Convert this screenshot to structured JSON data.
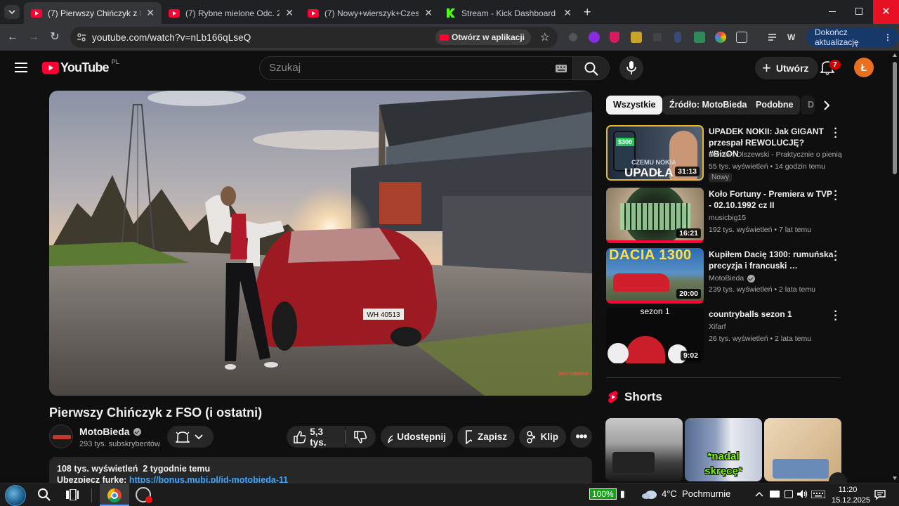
{
  "browser": {
    "tabs": [
      {
        "label": "(7) Pierwszy Chińczyk z FSO (i o",
        "active": true
      },
      {
        "label": "(7) Rybne mielone Odc. 219 #st",
        "active": false
      },
      {
        "label": "(7) Nowy+wierszyk+Czesia xvid",
        "active": false
      },
      {
        "label": "Stream - Kick Dashboard",
        "active": false
      }
    ],
    "url": "youtube.com/watch?v=nLb166qLseQ",
    "open_in_app": "Otwórz w aplikacji",
    "update_label": "Dokończ aktualizację"
  },
  "youtube": {
    "logo_text": "YouTube",
    "region": "PL",
    "search_placeholder": "Szukaj",
    "create_label": "Utwórz",
    "notifications": "7",
    "avatar_letter": "Ł"
  },
  "video": {
    "title": "Pierwszy Chińczyk z FSO (i ostatni)",
    "plate": "WH 40513",
    "watermark": "MOTOBIEDA",
    "channel": "MotoBieda",
    "subscribers": "293 tys. subskrybentów",
    "likes": "5,3 tys.",
    "share": "Udostępnij",
    "save": "Zapisz",
    "clip": "Klip",
    "views_line": "108 tys. wyświetleń  2 tygodnie temu",
    "desc_prefix": "Ubezpiecz furkę: ",
    "desc_link": "https://bonus.mubi.pl/id-motobieda-11"
  },
  "sidebar": {
    "chips": [
      "Wszystkie",
      "Źródło: MotoBieda",
      "Podobne",
      "D"
    ],
    "recommendations": [
      {
        "title": "UPADEK NOKII: Jak GIGANT przespał REWOLUCJĘ? #BizON",
        "channel": "Damian Olszewski - Praktycznie o pienią…",
        "meta": "55 tys. wyświetleń • 14 godzin temu",
        "duration": "31:13",
        "badge": "Nowy",
        "thumb_text": "UPADŁA",
        "thumb_top": "CZEMU NOKIA",
        "thumb_price": "$300"
      },
      {
        "title": "Koło Fortuny - Premiera w TVP - 02.10.1992 cz II",
        "channel": "musicbig15",
        "meta": "192 tys. wyświetleń • 7 lat temu",
        "duration": "16:21"
      },
      {
        "title": "Kupiłem Dacię 1300: rumuńska precyzja i francuski …",
        "channel": "MotoBieda",
        "meta": "239 tys. wyświetleń • 2 lata temu",
        "duration": "20:00",
        "thumb_text": "DACIA 1300"
      },
      {
        "title": "countryballs sezon 1",
        "channel": "Xifarf",
        "meta": "26 tys. wyświetleń • 2 lata temu",
        "duration": "9:02",
        "thumb_text": "sezon 1"
      }
    ],
    "shorts_label": "Shorts",
    "short_overlay": "*nadal skręcę*"
  },
  "taskbar": {
    "battery": "100%",
    "weather": "4°C  Pochmurnie",
    "time": "11:20",
    "date": "15.12.2025"
  }
}
